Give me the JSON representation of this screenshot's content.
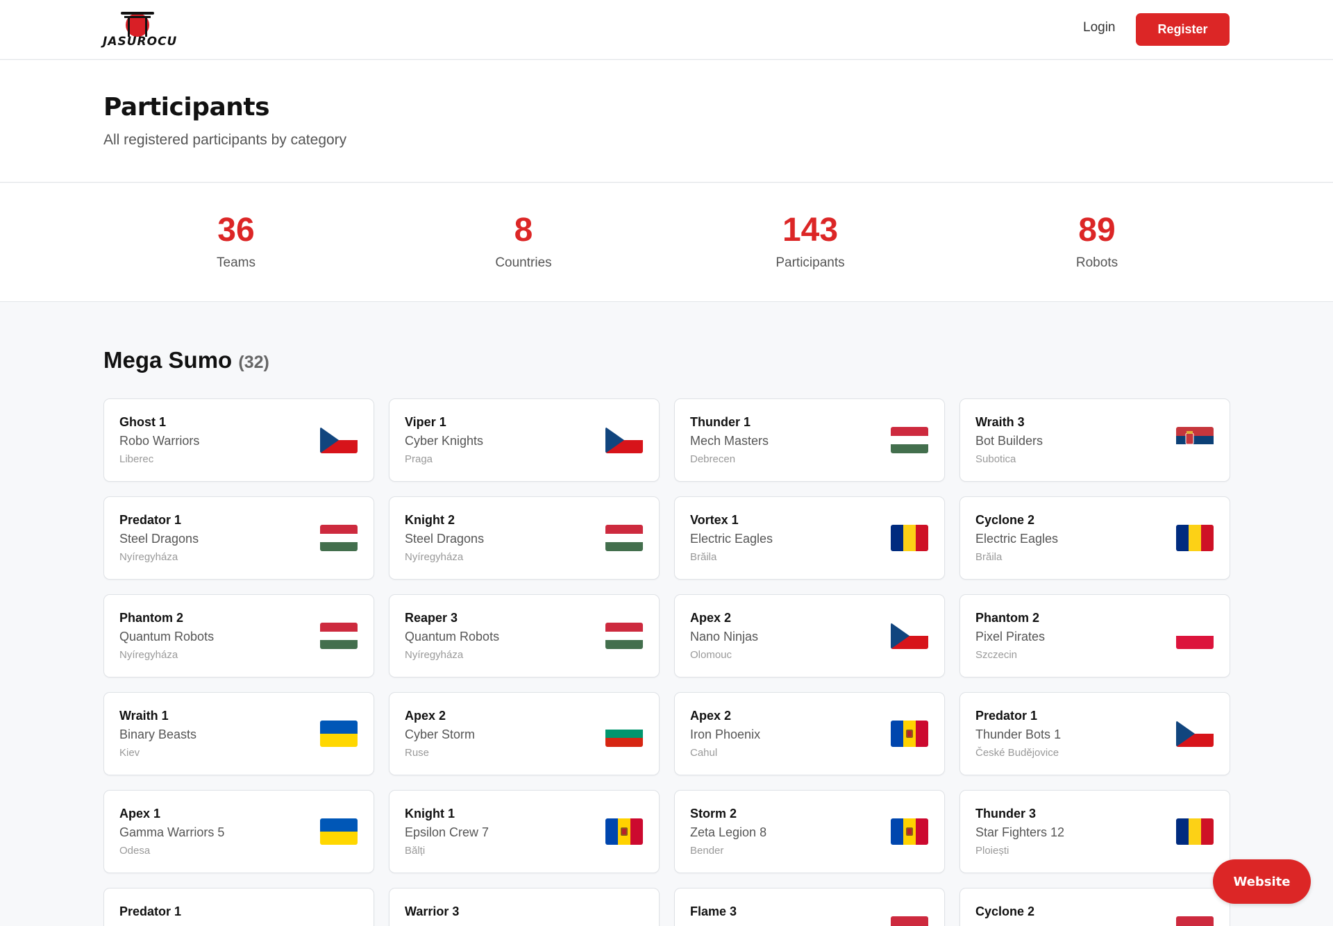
{
  "header": {
    "logo_text": "JASUROCU",
    "login_label": "Login",
    "register_label": "Register"
  },
  "hero": {
    "title": "Participants",
    "subtitle": "All registered participants by category"
  },
  "stats": [
    {
      "value": "36",
      "label": "Teams"
    },
    {
      "value": "8",
      "label": "Countries"
    },
    {
      "value": "143",
      "label": "Participants"
    },
    {
      "value": "89",
      "label": "Robots"
    }
  ],
  "section": {
    "title": "Mega Sumo",
    "count": "(32)"
  },
  "cards": [
    {
      "robot": "Ghost 1",
      "team": "Robo Warriors",
      "city": "Liberec",
      "flag": "czech"
    },
    {
      "robot": "Viper 1",
      "team": "Cyber Knights",
      "city": "Praga",
      "flag": "czech"
    },
    {
      "robot": "Thunder 1",
      "team": "Mech Masters",
      "city": "Debrecen",
      "flag": "hungary"
    },
    {
      "robot": "Wraith 3",
      "team": "Bot Builders",
      "city": "Subotica",
      "flag": "serbia"
    },
    {
      "robot": "Predator 1",
      "team": "Steel Dragons",
      "city": "Nyíregyháza",
      "flag": "hungary"
    },
    {
      "robot": "Knight 2",
      "team": "Steel Dragons",
      "city": "Nyíregyháza",
      "flag": "hungary"
    },
    {
      "robot": "Vortex 1",
      "team": "Electric Eagles",
      "city": "Brăila",
      "flag": "romania"
    },
    {
      "robot": "Cyclone 2",
      "team": "Electric Eagles",
      "city": "Brăila",
      "flag": "romania"
    },
    {
      "robot": "Phantom 2",
      "team": "Quantum Robots",
      "city": "Nyíregyháza",
      "flag": "hungary"
    },
    {
      "robot": "Reaper 3",
      "team": "Quantum Robots",
      "city": "Nyíregyháza",
      "flag": "hungary"
    },
    {
      "robot": "Apex 2",
      "team": "Nano Ninjas",
      "city": "Olomouc",
      "flag": "czech"
    },
    {
      "robot": "Phantom 2",
      "team": "Pixel Pirates",
      "city": "Szczecin",
      "flag": "poland"
    },
    {
      "robot": "Wraith 1",
      "team": "Binary Beasts",
      "city": "Kiev",
      "flag": "ukraine"
    },
    {
      "robot": "Apex 2",
      "team": "Cyber Storm",
      "city": "Ruse",
      "flag": "bulgaria"
    },
    {
      "robot": "Apex 2",
      "team": "Iron Phoenix",
      "city": "Cahul",
      "flag": "moldova"
    },
    {
      "robot": "Predator 1",
      "team": "Thunder Bots 1",
      "city": "České Budějovice",
      "flag": "czech"
    },
    {
      "robot": "Apex 1",
      "team": "Gamma Warriors 5",
      "city": "Odesa",
      "flag": "ukraine"
    },
    {
      "robot": "Knight 1",
      "team": "Epsilon Crew 7",
      "city": "Bălți",
      "flag": "moldova"
    },
    {
      "robot": "Storm 2",
      "team": "Zeta Legion 8",
      "city": "Bender",
      "flag": "moldova"
    },
    {
      "robot": "Thunder 3",
      "team": "Star Fighters 12",
      "city": "Ploiești",
      "flag": "romania"
    },
    {
      "robot": "Predator 1",
      "team": "",
      "city": "",
      "flag": "none"
    },
    {
      "robot": "Warrior 3",
      "team": "",
      "city": "",
      "flag": "none"
    },
    {
      "robot": "Flame 3",
      "team": "",
      "city": "",
      "flag": "partial"
    },
    {
      "robot": "Cyclone 2",
      "team": "",
      "city": "",
      "flag": "partial"
    }
  ],
  "website_label": "Website",
  "colors": {
    "accent": "#dc2626",
    "background": "#f7f8fa",
    "card": "#ffffff"
  }
}
